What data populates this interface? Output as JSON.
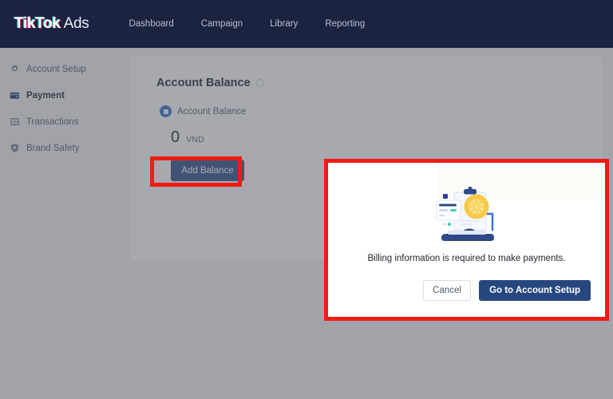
{
  "topbar": {
    "brand_primary": "TikTok",
    "brand_secondary": " Ads",
    "nav": [
      {
        "label": "Dashboard"
      },
      {
        "label": "Campaign"
      },
      {
        "label": "Library"
      },
      {
        "label": "Reporting"
      }
    ]
  },
  "sidebar": {
    "items": [
      {
        "label": "Account Setup",
        "icon": "gear-icon",
        "active": false
      },
      {
        "label": "Payment",
        "icon": "wallet-icon",
        "active": true
      },
      {
        "label": "Transactions",
        "icon": "grid-icon",
        "active": false
      },
      {
        "label": "Brand Safety",
        "icon": "shield-icon",
        "active": false
      }
    ]
  },
  "main": {
    "card_title": "Account Balance",
    "balance_label": "Account Balance",
    "balance_amount": "0",
    "balance_currency": "VND",
    "add_balance_label": "Add Balance"
  },
  "modal": {
    "message": "Billing information is required to make payments.",
    "cancel_label": "Cancel",
    "primary_label": "Go to Account Setup"
  },
  "colors": {
    "topbar_bg": "#1b2340",
    "accent_blue": "#27477f",
    "button_blue": "#2d4a86",
    "annotation_red": "#ee1c16",
    "illustration_yellow": "#f7c948",
    "illustration_blue": "#2d4a86",
    "illustration_teal": "#3fd4b0"
  }
}
